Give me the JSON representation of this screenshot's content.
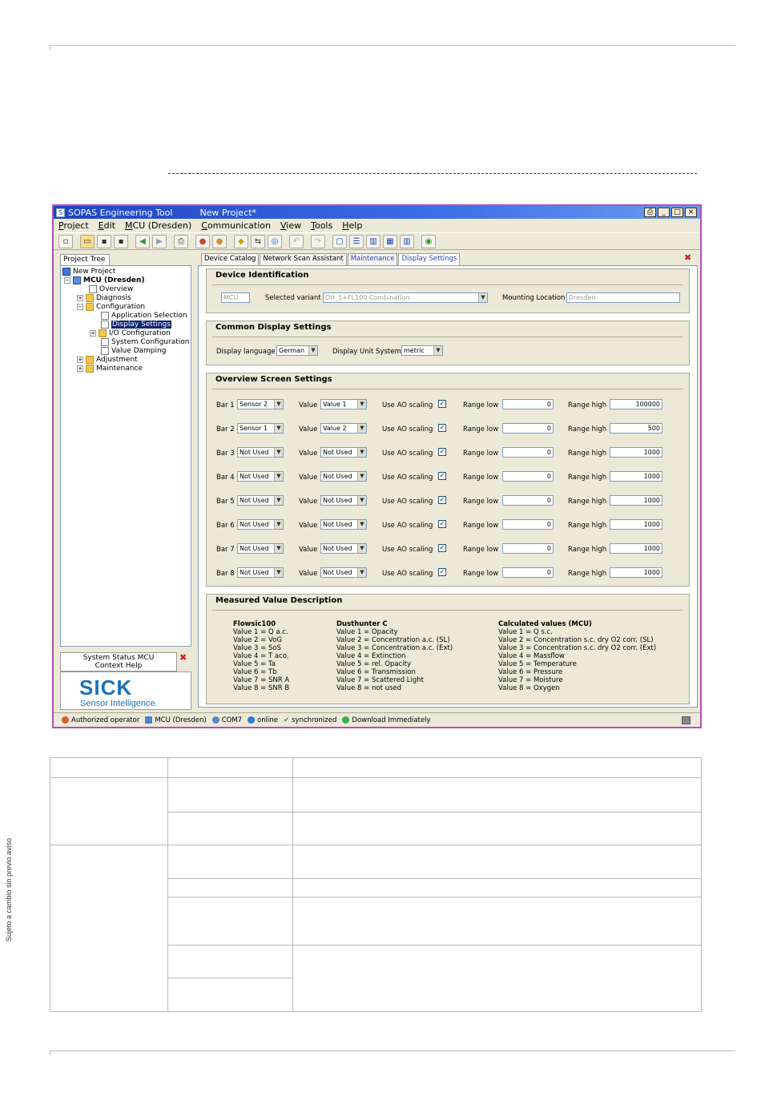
{
  "side_note": "Sujeto a cambio sin previo aviso",
  "window": {
    "title": "SOPAS Engineering Tool",
    "project_title": "New Project*",
    "controls": [
      "⎙",
      "_",
      "□",
      "×"
    ],
    "menu": [
      "Project",
      "Edit",
      "MCU (Dresden)",
      "Communication",
      "View",
      "Tools",
      "Help"
    ]
  },
  "project_tree": {
    "tab_label": "Project Tree",
    "items": [
      {
        "label": "New Project"
      },
      {
        "label": "MCU (Dresden)"
      },
      {
        "label": "Overview"
      },
      {
        "label": "Diagnosis"
      },
      {
        "label": "Configuration"
      },
      {
        "label": "Application Selection"
      },
      {
        "label": "Display Settings"
      },
      {
        "label": "I/O Configuration"
      },
      {
        "label": "System Configuration"
      },
      {
        "label": "Value Damping"
      },
      {
        "label": "Adjustment"
      },
      {
        "label": "Maintenance"
      }
    ]
  },
  "status_panel": {
    "line1": "System Status MCU",
    "line2": "Context Help",
    "logo_text": "SICK",
    "logo_tagline": "Sensor Intelligence."
  },
  "tabs": [
    "Device Catalog",
    "Network Scan Assistant",
    "Maintenance",
    "Display Settings"
  ],
  "device_identification": {
    "title": "Device Identification",
    "device_field": "MCU",
    "variant_label": "Selected variant",
    "variant_value": "DH_S+FL100 Combination",
    "mounting_label": "Mounting Location",
    "mounting_value": "Dresden"
  },
  "common_display": {
    "title": "Common Display Settings",
    "language_label": "Display language",
    "language_value": "German",
    "unit_label": "Display Unit System",
    "unit_value": "metric"
  },
  "overview_screen": {
    "title": "Overview Screen Settings",
    "value_label": "Value",
    "ao_label": "Use AO scaling",
    "range_low_label": "Range low",
    "range_high_label": "Range high",
    "bars": [
      {
        "label": "Bar 1",
        "source": "Sensor 2",
        "value": "Value 1",
        "ao": true,
        "low": "0",
        "high": "100000"
      },
      {
        "label": "Bar 2",
        "source": "Sensor 1",
        "value": "Value 2",
        "ao": true,
        "low": "0",
        "high": "500"
      },
      {
        "label": "Bar 3",
        "source": "Not Used",
        "value": "Not Used",
        "ao": true,
        "low": "0",
        "high": "1000"
      },
      {
        "label": "Bar 4",
        "source": "Not Used",
        "value": "Not Used",
        "ao": true,
        "low": "0",
        "high": "1000"
      },
      {
        "label": "Bar 5",
        "source": "Not Used",
        "value": "Not Used",
        "ao": true,
        "low": "0",
        "high": "1000"
      },
      {
        "label": "Bar 6",
        "source": "Not Used",
        "value": "Not Used",
        "ao": true,
        "low": "0",
        "high": "1000"
      },
      {
        "label": "Bar 7",
        "source": "Not Used",
        "value": "Not Used",
        "ao": true,
        "low": "0",
        "high": "1000"
      },
      {
        "label": "Bar 8",
        "source": "Not Used",
        "value": "Not Used",
        "ao": true,
        "low": "0",
        "high": "1000"
      }
    ]
  },
  "measured_value": {
    "title": "Measured Value Description",
    "columns": [
      {
        "heading": "Flowsic100",
        "lines": [
          "Value 1 = Q a.c.",
          "Value 2 = VoG",
          "Value 3 = SoS",
          "Value 4 = T aco.",
          "Value 5 = Ta",
          "Value 6 = Tb",
          "Value 7 = SNR A",
          "Value 8 = SNR B"
        ]
      },
      {
        "heading": "Dusthunter C",
        "lines": [
          "Value 1 = Opacity",
          "Value 2 = Concentration a.c. (SL)",
          "Value 3 = Concentration a.c. (Ext)",
          "Value 4 = Extinction",
          "Value 5 = rel. Opacity",
          "Value 6 = Transmission",
          "Value 7 = Scattered Light",
          "Value 8 = not used"
        ]
      },
      {
        "heading": "Calculated values (MCU)",
        "lines": [
          "Value 1 = Q s.c.",
          "Value 2 = Concentration s.c. dry O2 corr. (SL)",
          "Value 3 = Concentration s.c. dry O2 corr. (Ext)",
          "Value 4 = Massflow",
          "Value 5 = Temperature",
          "Value 6 = Pressure",
          "Value 7 = Moisture",
          "Value 8 = Oxygen"
        ]
      }
    ]
  },
  "statusbar": [
    "Authorized operator",
    "MCU (Dresden)",
    "COM7",
    "online",
    "synchronized",
    "Download Immediately"
  ],
  "colors": {
    "title_bar": "#1e44c4",
    "window_border": "#b44fb5",
    "tab_active_text": "#2545b0",
    "logo": "#1a72b8"
  }
}
